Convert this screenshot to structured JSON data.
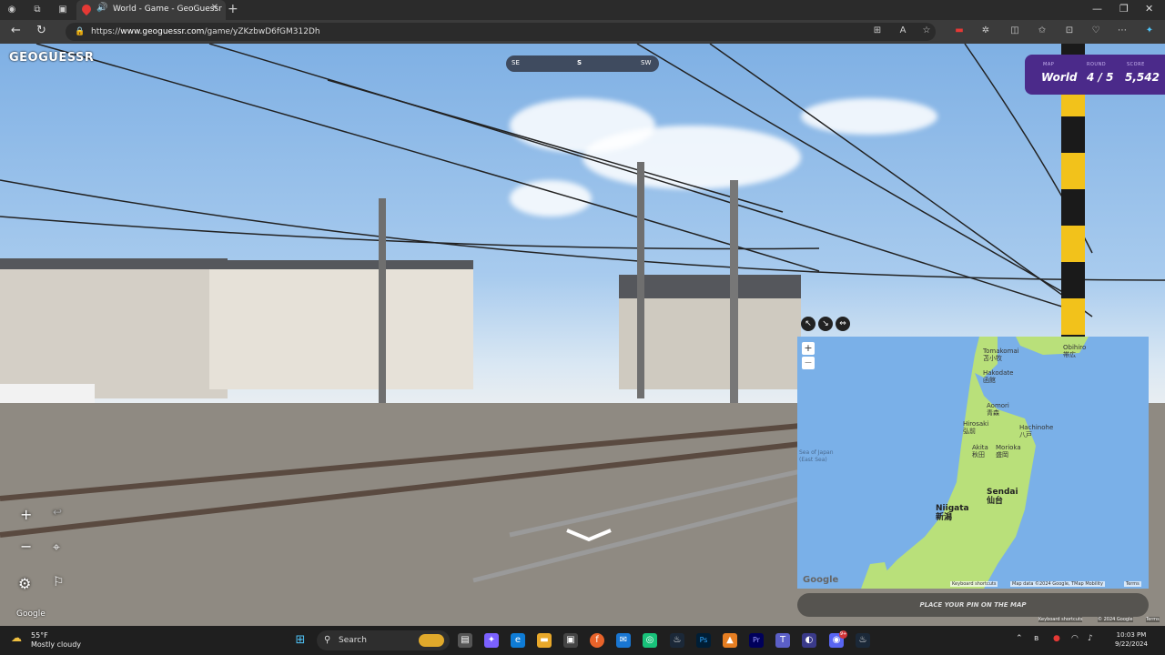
{
  "browser": {
    "tab_title": "World - Game - GeoGuessr",
    "url_prefix": "https://",
    "url_domain": "www.geoguessr.com",
    "url_path": "/game/yZKzbwD6fGM312Dh"
  },
  "game": {
    "logo": "GEOGUESSR",
    "compass": [
      "SE",
      "S",
      "SW"
    ],
    "map_label": "MAP",
    "map_value": "World",
    "round_label": "ROUND",
    "round_value": "4 / 5",
    "score_label": "SCORE",
    "score_value": "5,542",
    "google_label": "Google",
    "place_pin": "PLACE YOUR PIN ON THE MAP",
    "keyboard_shortcuts": "Keyboard shortcuts",
    "copyright": "© 2024 Google",
    "terms": "Terms"
  },
  "minimap": {
    "cities": [
      {
        "en": "Tomakomai",
        "jp": "苫小牧"
      },
      {
        "en": "Obihiro",
        "jp": "帯広"
      },
      {
        "en": "Hakodate",
        "jp": "函館"
      },
      {
        "en": "Aomori",
        "jp": "青森"
      },
      {
        "en": "Hirosaki",
        "jp": "弘前"
      },
      {
        "en": "Hachinohe",
        "jp": "八戸"
      },
      {
        "en": "Akita",
        "jp": "秋田"
      },
      {
        "en": "Morioka",
        "jp": "盛岡"
      },
      {
        "en": "Sendai",
        "jp": "仙台"
      },
      {
        "en": "Niigata",
        "jp": "新潟"
      }
    ],
    "sea": "Sea of Japan\n(East Sea)",
    "google": "Google",
    "attrib_kbd": "Keyboard shortcuts",
    "attrib_data": "Map data ©2024 Google, TMap Mobility",
    "attrib_terms": "Terms"
  },
  "taskbar": {
    "temp": "55°F",
    "weather": "Mostly cloudy",
    "search": "Search",
    "time": "10:03 PM",
    "date": "9/22/2024",
    "discord_badge": "9+"
  },
  "colors": {
    "hud": "#4b2a8a",
    "land": "#b9e07a",
    "water": "#7ab0e8"
  }
}
